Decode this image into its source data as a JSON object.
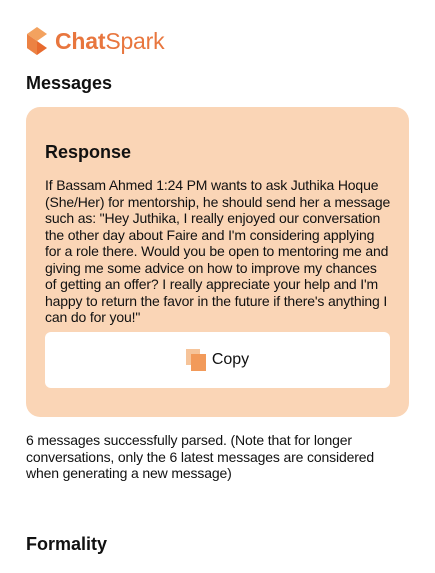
{
  "brand": {
    "name_strong": "Chat",
    "name_light": "Spark",
    "logo_icon": "chatspark-logo-icon",
    "color": "#e8763e"
  },
  "messages": {
    "title": "Messages"
  },
  "response": {
    "heading": "Response",
    "text": "If Bassam Ahmed 1:24 PM wants to ask Juthika Hoque (She/Her) for mentorship, he should send her a message such as: \"Hey Juthika, I really enjoyed our conversation the other day about Faire and I'm considering applying for a role there. Would you be open to mentoring me and giving me some advice on how to improve my chances of getting an offer? I really appreciate your help and I'm happy to return the favor in the future if there's anything I can do for you!\"",
    "copy_label": "Copy",
    "copy_icon": "copy-icon",
    "card_color": "#fad5b6"
  },
  "status": {
    "text": "6 messages successfully parsed. (Note that for longer conversations, only the 6 latest messages are considered when generating a new message)"
  },
  "formality": {
    "title": "Formality"
  }
}
